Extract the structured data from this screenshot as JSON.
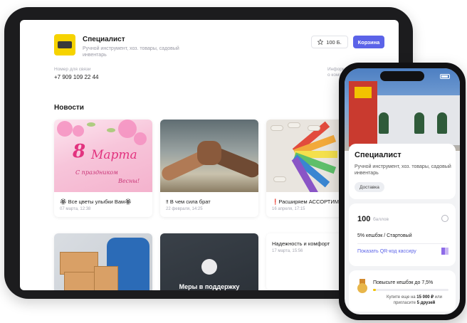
{
  "tablet": {
    "store": {
      "name": "Специалист",
      "description": "Ручной инструмент, хоз. товары, садовый инвентарь"
    },
    "header": {
      "points_label": "100 Б.",
      "cart_label": "Корзина"
    },
    "contact": {
      "label": "Номер для связи",
      "phone": "+7 909 109 22 44",
      "info_label": "Информация о компании"
    },
    "news": {
      "title": "Новости",
      "items": [
        {
          "title": "🏵 Все цветы улыбки Вам🏵",
          "date": "07 марта, 12:38",
          "image": {
            "big8": "8",
            "word": "Марта",
            "greet1": "С праздником",
            "greet2": "Весны!"
          }
        },
        {
          "title": "‼ В чем сила брат",
          "date": "22 февраля, 14:25"
        },
        {
          "title": "❗Расширяем АССОРТИМЕНТ",
          "date": "16 апреля, 17:15"
        },
        {
          "title": "",
          "date": ""
        },
        {
          "title": "",
          "date": "",
          "image_text": "Меры в поддержку"
        },
        {
          "title": "Надежность и комфорт",
          "date": "17 марта, 15:56"
        }
      ]
    }
  },
  "phone": {
    "status_time": "",
    "store": {
      "name": "Специалист",
      "description": "Ручной инструмент, хоз. товары, садовый инвентарь",
      "delivery_label": "Доставка"
    },
    "points": {
      "value": "100",
      "label": "баллов",
      "cashback": "5% кешбэк / Стартовый",
      "qr_link": "Показать QR-код кассиру"
    },
    "boost": {
      "title": "Повысьте кешбэк до 7,5%",
      "text_prefix": "Купите еще на",
      "amount": "15 000 ₽",
      "text_mid": "или пригласите",
      "friends": "5 друзей",
      "progress_fraction": 0.04
    }
  },
  "colors": {
    "accent": "#5b63e8",
    "logo": "#f6d300",
    "device_frame": "#1c1c1e"
  }
}
